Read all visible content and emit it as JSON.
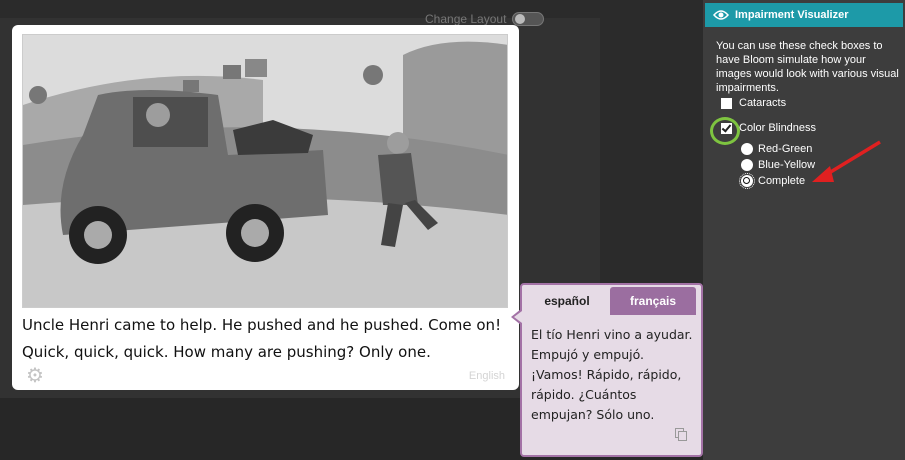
{
  "toolbar": {
    "change_layout_label": "Change Layout"
  },
  "page": {
    "story_text": "Uncle Henri came to help. He pushed and he pushed. Come on! Quick, quick, quick. How many are pushing? Only one.",
    "language_label": "English",
    "picture_alt": "grayscale illustration of a man pushing a truck"
  },
  "bubble": {
    "tabs": [
      {
        "label": "español",
        "active": true
      },
      {
        "label": "français",
        "active": false
      }
    ],
    "text": "El tío Henri vino a ayudar. Empujó y empujó. ¡Vamos! Rápido, rápido, rápido. ¿Cuántos empujan? Sólo uno."
  },
  "panel": {
    "title": "Impairment Visualizer",
    "description": "You can use these check boxes to have Bloom simulate how your images would look with various visual impairments.",
    "options": [
      {
        "label": "Cataracts",
        "checked": false
      },
      {
        "label": "Color Blindness",
        "checked": true
      }
    ],
    "color_blindness_types": [
      {
        "label": "Red-Green",
        "selected": false
      },
      {
        "label": "Blue-Yellow",
        "selected": false
      },
      {
        "label": "Complete",
        "selected": true
      }
    ]
  },
  "colors": {
    "accent": "#1d9aa8",
    "bubble_bg": "#e6dbe6",
    "bubble_border": "#a372a6",
    "highlight_ring": "#7ec440",
    "arrow": "#e02020"
  }
}
